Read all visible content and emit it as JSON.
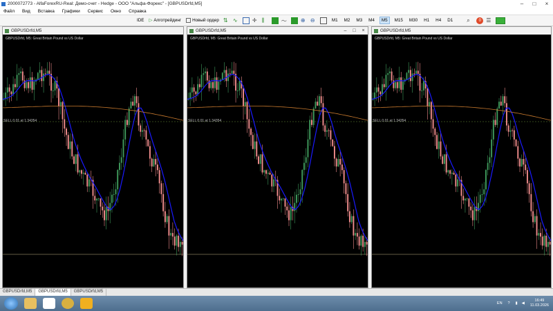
{
  "window": {
    "title": "2000072773 - AlfaForexRU-Real: Демо-счет - Hedge - ООО \"Альфа-Форекс\" - [GBPUSDrfd,M5]",
    "controls": [
      "–",
      "□",
      "×"
    ]
  },
  "menu": [
    "Файл",
    "Вид",
    "Вставка",
    "Графики",
    "Сервис",
    "Окно",
    "Справка"
  ],
  "toolbar": {
    "ide_label": "IDE",
    "algo_label": "Алготрейдинг",
    "new_order_label": "Новый ордер",
    "timeframes": [
      "M1",
      "M2",
      "M3",
      "M4",
      "M5",
      "M15",
      "M30",
      "H1",
      "H4",
      "D1"
    ],
    "active_timeframe": "M5",
    "notifications_count": "0"
  },
  "charts": [
    {
      "window_title": "GBPUSDrfd,M5",
      "symbol_line": "GBPUSDrfd, M5:  Great Britain Pound vs US Dollar",
      "trade_line": "SELL 0.01 at 1.34354",
      "has_window_buttons": false
    },
    {
      "window_title": "GBPUSDrfd,M5",
      "symbol_line": "GBPUSDrfd, M5:  Great Britain Pound vs US Dollar",
      "trade_line": "SELL 0.01 at 1.34354",
      "has_window_buttons": true
    },
    {
      "window_title": "GBPUSDrfd,M5",
      "symbol_line": "GBPUSDrfd, M5:  Great Britain Pound vs US Dollar",
      "trade_line": "SELL 0.01 at 1.34354",
      "has_window_buttons": false
    }
  ],
  "colors": {
    "bull": "#3f9a5c",
    "bear": "#f08c8c",
    "ma_fast": "#1a1aff",
    "ma_slow": "#c97a2e",
    "trade_line": "#6b8e3a"
  },
  "tabs": [
    "GBPUSDrfd,M5",
    "GBPUSDrfd,M5",
    "GBPUSDrfd,M5"
  ],
  "active_tab_index": 1,
  "taskbar": {
    "apps": [
      "folder",
      "yandex-browser",
      "sync",
      "mt5"
    ],
    "lang": "EN",
    "time": "16:49",
    "date": "11.03.2026"
  }
}
